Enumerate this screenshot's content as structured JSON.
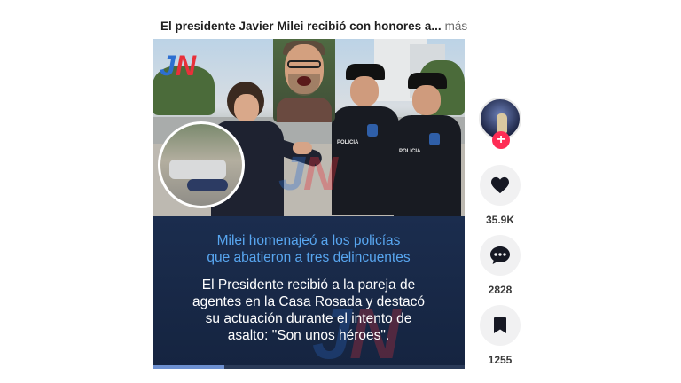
{
  "post": {
    "caption": "El presidente Javier Milei recibió con honores a...",
    "more_label": "más"
  },
  "video": {
    "overlay_headline_line1": "Milei homenajeó a los policías",
    "overlay_headline_line2": "que abatieron a tres delincuentes",
    "overlay_body_line1": "El Presidente recibió a la pareja de",
    "overlay_body_line2": "agentes en la Casa Rosada y destacó",
    "overlay_body_line3": "su actuación durante el intento de",
    "overlay_body_line4": "asalto: \"Son unos héroes\".",
    "logo_text": "JN",
    "uniform_label": "POLICIA",
    "progress_fraction": 0.23
  },
  "actions": {
    "follow_symbol": "+",
    "likes": "35.9K",
    "comments": "2828",
    "bookmarks": "1255"
  },
  "icons": {
    "like": "heart-icon",
    "comment": "comment-dots-icon",
    "bookmark": "bookmark-icon",
    "follow": "plus-icon"
  },
  "colors": {
    "follow_badge": "#fe2c55",
    "headline": "#58a6f0",
    "logo_blue": "#2d6fd1",
    "logo_red": "#e8303a"
  }
}
